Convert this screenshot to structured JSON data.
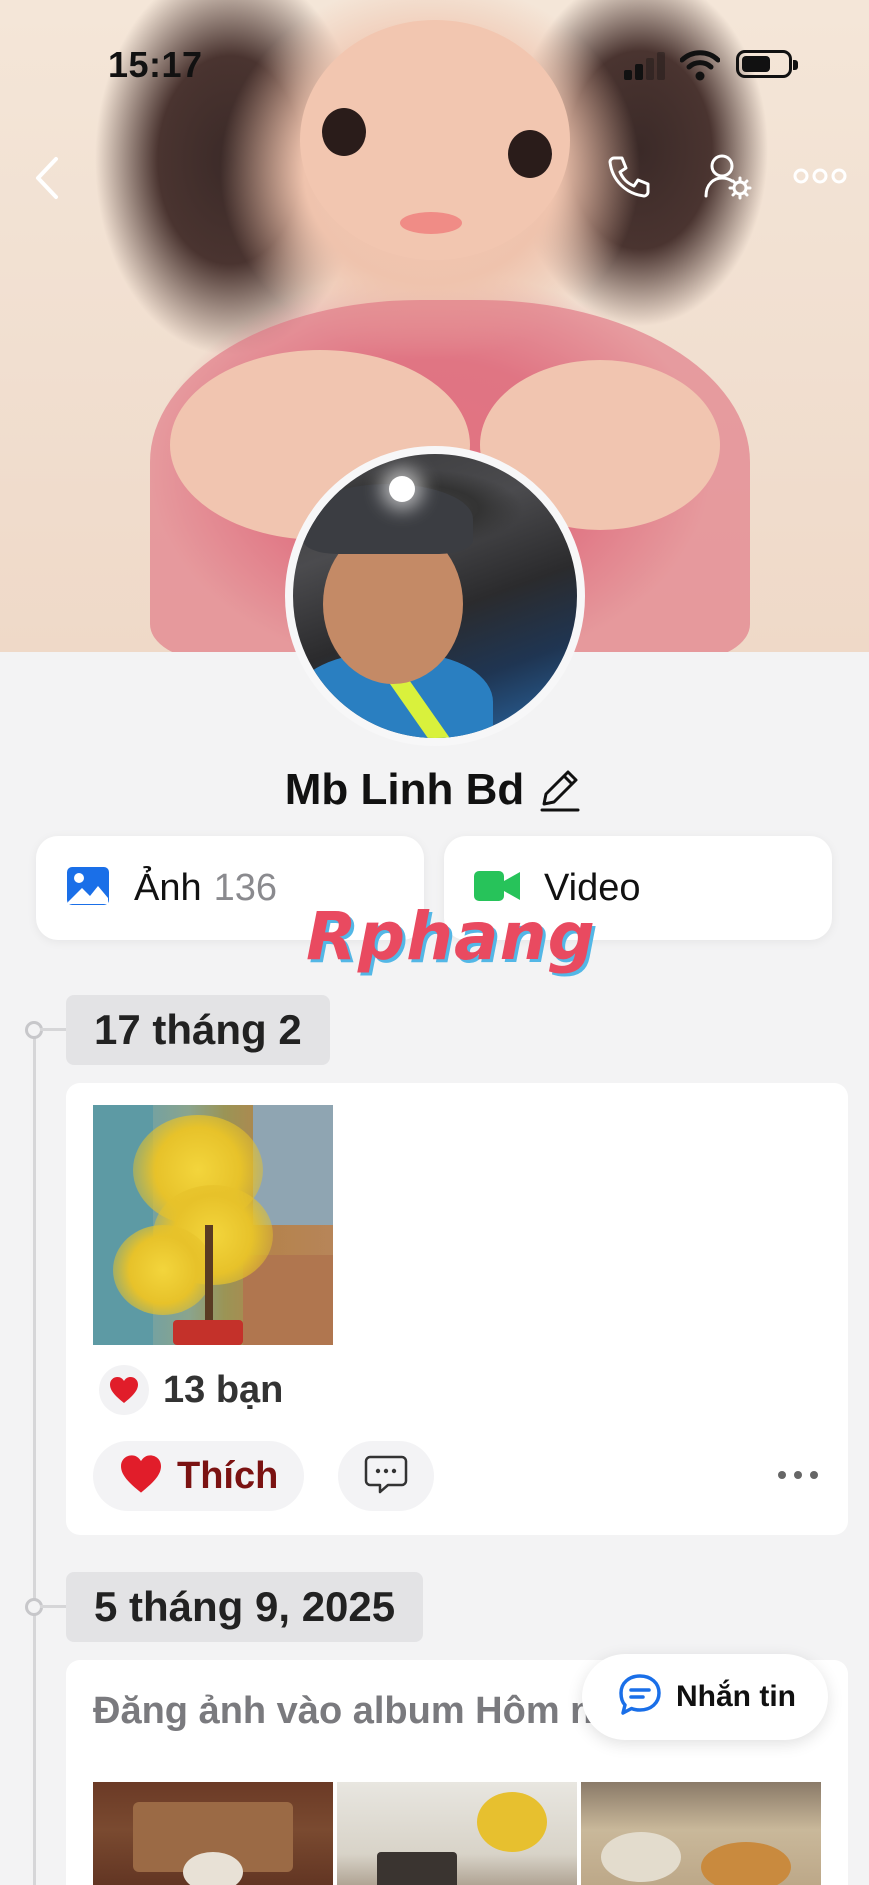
{
  "status_bar": {
    "time": "15:17"
  },
  "profile": {
    "name": "Mb Linh Bd",
    "photo_label": "Ảnh",
    "photo_count": "136",
    "video_label": "Video"
  },
  "watermark": "Rphang",
  "timeline": [
    {
      "date": "17 tháng 2",
      "reaction_count": "13 bạn",
      "like_label": "Thích"
    },
    {
      "date": "5 tháng 9, 2025",
      "text": "Đăng ảnh vào album Hôm n"
    }
  ],
  "chat_button": {
    "label": "Nhắn tin"
  },
  "colors": {
    "accent_blue": "#1a6fe8",
    "video_green": "#27c35a",
    "like_red": "#7b1212",
    "heart_red": "#e11d2a",
    "background": "#f3f3f4"
  },
  "icons": [
    "back-icon",
    "phone-icon",
    "friend-settings-icon",
    "more-icon",
    "edit-icon",
    "photo-icon",
    "video-icon",
    "heart-icon",
    "comment-icon",
    "chat-icon"
  ]
}
